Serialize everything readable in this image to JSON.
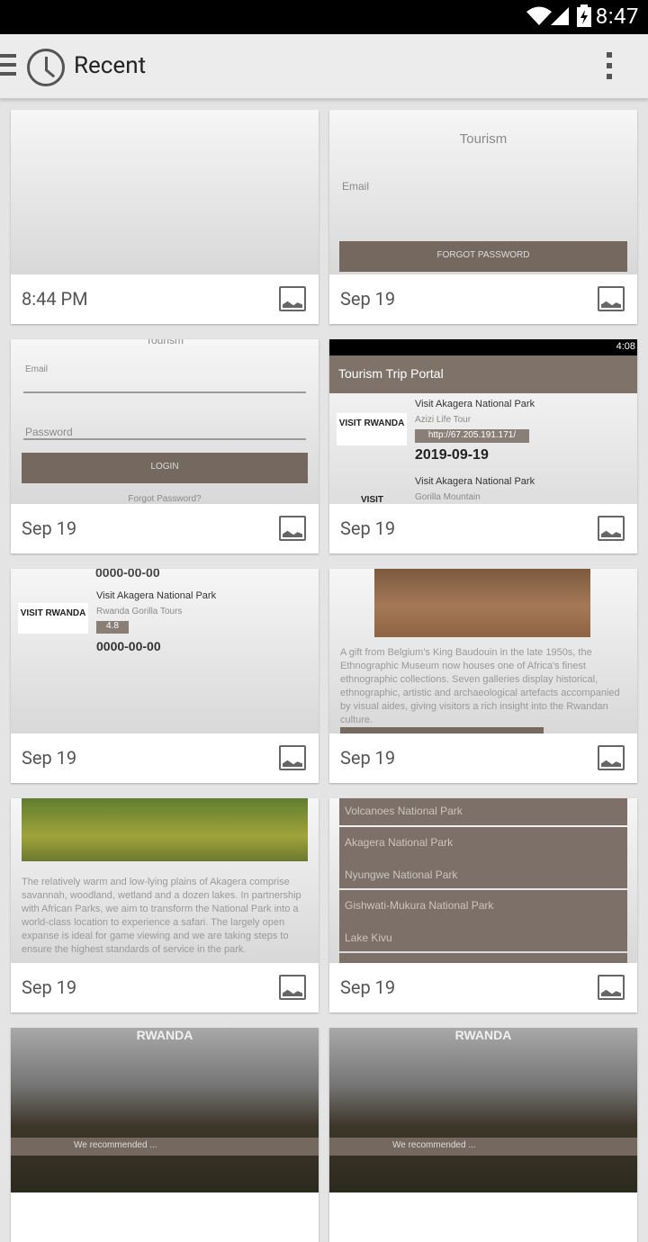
{
  "status_bar": {
    "time": "8:47"
  },
  "app_bar": {
    "title": "Recent"
  },
  "cards": [
    {
      "caption": "8:44 PM"
    },
    {
      "caption": "Sep 19",
      "thumb": {
        "title": "Tourism",
        "field": "Email",
        "button": "FORGOT PASSWORD"
      }
    },
    {
      "caption": "Sep 19",
      "thumb": {
        "top": "Tourism",
        "field1": "Email",
        "field2": "Password",
        "button": "LOGIN",
        "link": "Forgot Password?"
      }
    },
    {
      "caption": "Sep 19",
      "thumb": {
        "status_time": "4:08",
        "header": "Tourism Trip Portal",
        "item1_title": "Visit Akagera National Park",
        "item1_sub": "Azizi Life Tour",
        "item1_url": "http://67.205.191.171/",
        "item1_date": "2019-09-19",
        "item2_title": "Visit Akagera National Park",
        "item2_sub": "Gorilla Mountain",
        "logo1": "VISIT RWANDA",
        "logo2": "VISIT"
      }
    },
    {
      "caption": "Sep 19",
      "thumb": {
        "date_top": "0000-00-00",
        "item_title": "Visit Akagera National Park",
        "item_sub": "Rwanda Gorilla Tours",
        "badge": "4.8",
        "date": "0000-00-00",
        "logo": "VISIT RWANDA"
      }
    },
    {
      "caption": "Sep 19",
      "thumb": {
        "text": "A gift from Belgium's King Baudouin in the late 1950s, the Ethnographic Museum now houses one of Africa's finest ethnographic collections. Seven galleries display historical, ethnographic, artistic and archaeological artefacts accompanied by visual aides, giving visitors a rich insight into the Rwandan culture."
      }
    },
    {
      "caption": "Sep 19",
      "thumb": {
        "text": "The relatively warm and low-lying plains of Akagera comprise savannah, woodland, wetland and a dozen lakes. In partnership with African Parks, we aim to transform the National Park into a world-class location to experience a safari. The largely open expanse is ideal for game viewing and we are taking steps to ensure the highest standards of service in the park."
      }
    },
    {
      "caption": "Sep 19",
      "thumb": {
        "items": [
          "Volcanoes National Park",
          "Akagera National Park",
          "Nyungwe National Park",
          "Gishwati-Mukura National Park",
          "Lake Kivu"
        ]
      }
    },
    {
      "caption": "",
      "thumb": {
        "brand": "RWANDA",
        "line": "We recommended ..."
      }
    },
    {
      "caption": "",
      "thumb": {
        "brand": "RWANDA",
        "line": "We recommended ..."
      }
    }
  ]
}
